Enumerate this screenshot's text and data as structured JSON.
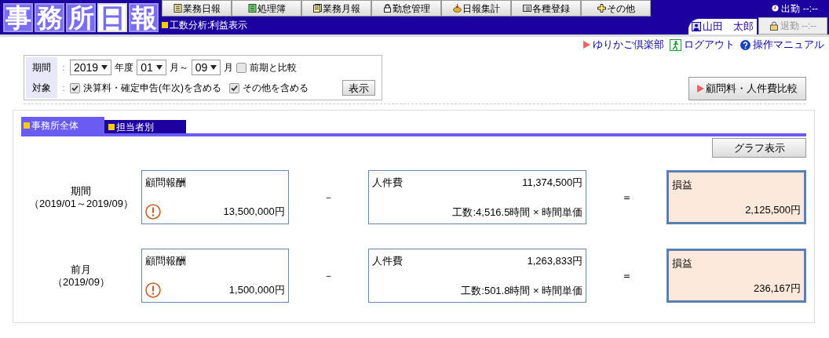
{
  "logo": [
    {
      "char": "事",
      "inverted": false
    },
    {
      "char": "務",
      "inverted": false
    },
    {
      "char": "所",
      "inverted": false
    },
    {
      "char": "日",
      "inverted": true
    },
    {
      "char": "報",
      "inverted": false
    }
  ],
  "menu": [
    {
      "label": "業務日報",
      "kind": "sheet"
    },
    {
      "label": "処理簿",
      "kind": "book"
    },
    {
      "label": "業務月報",
      "kind": "sheets"
    },
    {
      "label": "勤怠管理",
      "kind": "lock"
    },
    {
      "label": "日報集計",
      "kind": "pot"
    },
    {
      "label": "各種登録",
      "kind": "list"
    },
    {
      "label": "その他",
      "kind": "plus"
    }
  ],
  "page_title": "工数分析:利益表示",
  "clock_in": {
    "label": "出勤",
    "time": "--:--"
  },
  "user_tab": {
    "name": "山田　太郎",
    "selected": true
  },
  "clock_out": {
    "label": "退勤",
    "time": "--:--",
    "disabled": true
  },
  "links": [
    {
      "label": "ゆりかご倶楽部",
      "kind": "triangle"
    },
    {
      "label": "ログアウト",
      "kind": "exit"
    },
    {
      "label": "操作マニュアル",
      "kind": "help"
    }
  ],
  "filter": {
    "period_label": "期間",
    "colon": "：",
    "year": "2019",
    "year_unit": "年度",
    "from_month": "01",
    "from_unit": "月～",
    "to_month": "09",
    "to_unit": "月",
    "compare": {
      "label": "前期と比較",
      "checked": false
    },
    "target_label": "対象",
    "options": [
      {
        "label": "決算料・確定申告(年次)を含める",
        "checked": true
      },
      {
        "label": "その他を含める",
        "checked": true
      }
    ],
    "show_button": "表示"
  },
  "compare_button": "顧問料・人件費比較",
  "tabs": [
    {
      "label": "事務所全体",
      "selected": true
    },
    {
      "label": "担当者別",
      "selected": false
    }
  ],
  "graph_button": "グラフ表示",
  "rows": [
    {
      "period": "期間",
      "range": "（2019/01～2019/09）",
      "fee_label": "顧問報酬",
      "fee": "13,500,000円",
      "minus": "－",
      "cost_label": "人件費",
      "cost": "11,374,500円",
      "formula": "工数:4,516.5時間 × 時間単価",
      "equals": "＝",
      "profit_label": "損益",
      "profit": "2,125,500円"
    },
    {
      "period": "前月",
      "range": "（2019/09）",
      "fee_label": "顧問報酬",
      "fee": "1,500,000円",
      "minus": "－",
      "cost_label": "人件費",
      "cost": "1,263,833円",
      "formula": "工数:501.8時間 × 時間単価",
      "equals": "＝",
      "profit_label": "損益",
      "profit": "236,167円"
    }
  ]
}
